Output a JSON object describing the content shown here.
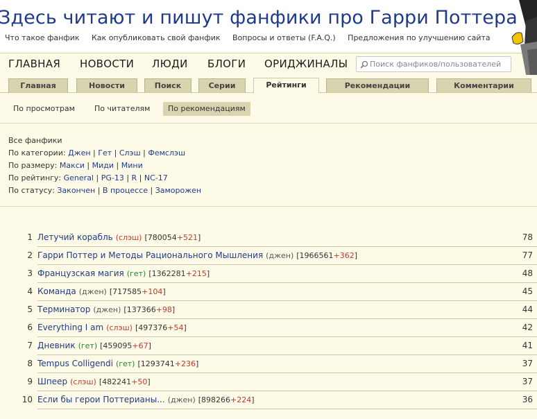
{
  "header": {
    "site_title": "Здесь читают и пишут фанфики про Гарри Поттера",
    "links": [
      "Что такое фанфик",
      "Как опубликовать свой фанфик",
      "Вопросы и ответы (F.A.Q.)",
      "Предложения по улучшению сайта"
    ]
  },
  "nav": {
    "items": [
      "ГЛАВНАЯ",
      "НОВОСТИ",
      "ЛЮДИ",
      "БЛОГИ",
      "ОРИДЖИНАЛЫ"
    ],
    "search_placeholder": "Поиск фанфиков/пользователей"
  },
  "tabs": [
    "Главная",
    "Новости",
    "Поиск",
    "Серии",
    "Рейтинги",
    "Рекомендации",
    "Комментарии"
  ],
  "active_tab": "Рейтинги",
  "subnav": {
    "items": [
      "По просмотрам",
      "По читателям",
      "По рекомендациям"
    ],
    "active": "По рекомендациям"
  },
  "filters": {
    "all": "Все фанфики",
    "category_label": "По категории:",
    "categories": [
      "Джен",
      "Гет",
      "Слэш",
      "Фемслэш"
    ],
    "size_label": "По размеру:",
    "sizes": [
      "Макси",
      "Миди",
      "Мини"
    ],
    "rating_label": "По рейтингу:",
    "ratings": [
      "General",
      "PG-13",
      "R",
      "NC-17"
    ],
    "status_label": "По статусу:",
    "statuses": [
      "Закончен",
      "В процессе",
      "Заморожен"
    ]
  },
  "ranking": [
    {
      "rank": "1",
      "title": "Летучий корабль",
      "category": "(слэш)",
      "cat_type": "slash",
      "views": "780054",
      "delta": "+521",
      "score": "78"
    },
    {
      "rank": "2",
      "title": "Гарри Поттер и Методы Рационального Мышления",
      "category": "(джен)",
      "cat_type": "gen",
      "views": "1966561",
      "delta": "+362",
      "score": "77"
    },
    {
      "rank": "3",
      "title": "Французская магия",
      "category": "(гет)",
      "cat_type": "het",
      "views": "1362281",
      "delta": "+215",
      "score": "48"
    },
    {
      "rank": "4",
      "title": "Команда",
      "category": "(джен)",
      "cat_type": "gen",
      "views": "717585",
      "delta": "+104",
      "score": "45"
    },
    {
      "rank": "5",
      "title": "Терминатор",
      "category": "(джен)",
      "cat_type": "gen",
      "views": "137366",
      "delta": "+98",
      "score": "44"
    },
    {
      "rank": "6",
      "title": "Everything I am",
      "category": "(слэш)",
      "cat_type": "slash",
      "views": "497376",
      "delta": "+54",
      "score": "42"
    },
    {
      "rank": "7",
      "title": "Дневник",
      "category": "(гет)",
      "cat_type": "het",
      "views": "459095",
      "delta": "+67",
      "score": "41"
    },
    {
      "rank": "8",
      "title": "Tempus Colligendi",
      "category": "(гет)",
      "cat_type": "het",
      "views": "1293741",
      "delta": "+236",
      "score": "37"
    },
    {
      "rank": "9",
      "title": "Шпеер",
      "category": "(слэш)",
      "cat_type": "slash",
      "views": "482241",
      "delta": "+50",
      "score": "37"
    },
    {
      "rank": "10",
      "title": "Если бы герои Поттерианы...",
      "category": "(джен)",
      "cat_type": "gen",
      "views": "898266",
      "delta": "+224",
      "score": "36"
    }
  ]
}
